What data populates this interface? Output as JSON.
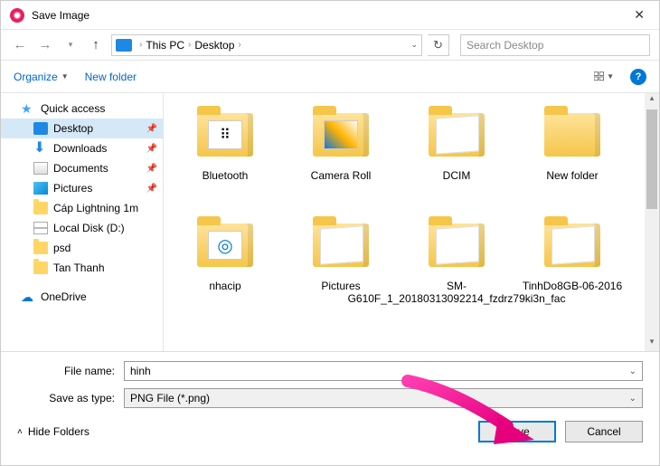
{
  "window": {
    "title": "Save Image"
  },
  "nav": {
    "breadcrumb": [
      "This PC",
      "Desktop"
    ],
    "search_placeholder": "Search Desktop"
  },
  "toolbar": {
    "organize": "Organize",
    "new_folder": "New folder"
  },
  "sidebar": {
    "quick_access": "Quick access",
    "items": [
      {
        "label": "Desktop",
        "pinned": true,
        "selected": true,
        "icon": "desktop"
      },
      {
        "label": "Downloads",
        "pinned": true,
        "icon": "download"
      },
      {
        "label": "Documents",
        "pinned": true,
        "icon": "doc"
      },
      {
        "label": "Pictures",
        "pinned": true,
        "icon": "pic"
      },
      {
        "label": "Cáp Lightning 1m",
        "icon": "folder"
      },
      {
        "label": "Local Disk (D:)",
        "icon": "disk"
      },
      {
        "label": "psd",
        "icon": "folder"
      },
      {
        "label": "Tan Thanh",
        "icon": "folder"
      }
    ],
    "onedrive": "OneDrive"
  },
  "files": [
    {
      "label": "Bluetooth",
      "variant": "preview-doc"
    },
    {
      "label": "Camera Roll",
      "variant": "preview-photo"
    },
    {
      "label": "DCIM",
      "variant": "open"
    },
    {
      "label": "New folder",
      "variant": "plain"
    },
    {
      "label": "nhacip",
      "variant": "preview-logo"
    },
    {
      "label": "Pictures",
      "variant": "open"
    },
    {
      "label": "SM-G610F_1_20180313092214_fzdrz79ki3n_fac",
      "variant": "open"
    },
    {
      "label": "TinhDo8GB-06-2016",
      "variant": "open"
    }
  ],
  "fields": {
    "filename_label": "File name:",
    "filename_value": "hinh",
    "saveas_label": "Save as type:",
    "saveas_value": "PNG File (*.png)"
  },
  "actions": {
    "hide_folders": "Hide Folders",
    "save": "Save",
    "cancel": "Cancel"
  }
}
